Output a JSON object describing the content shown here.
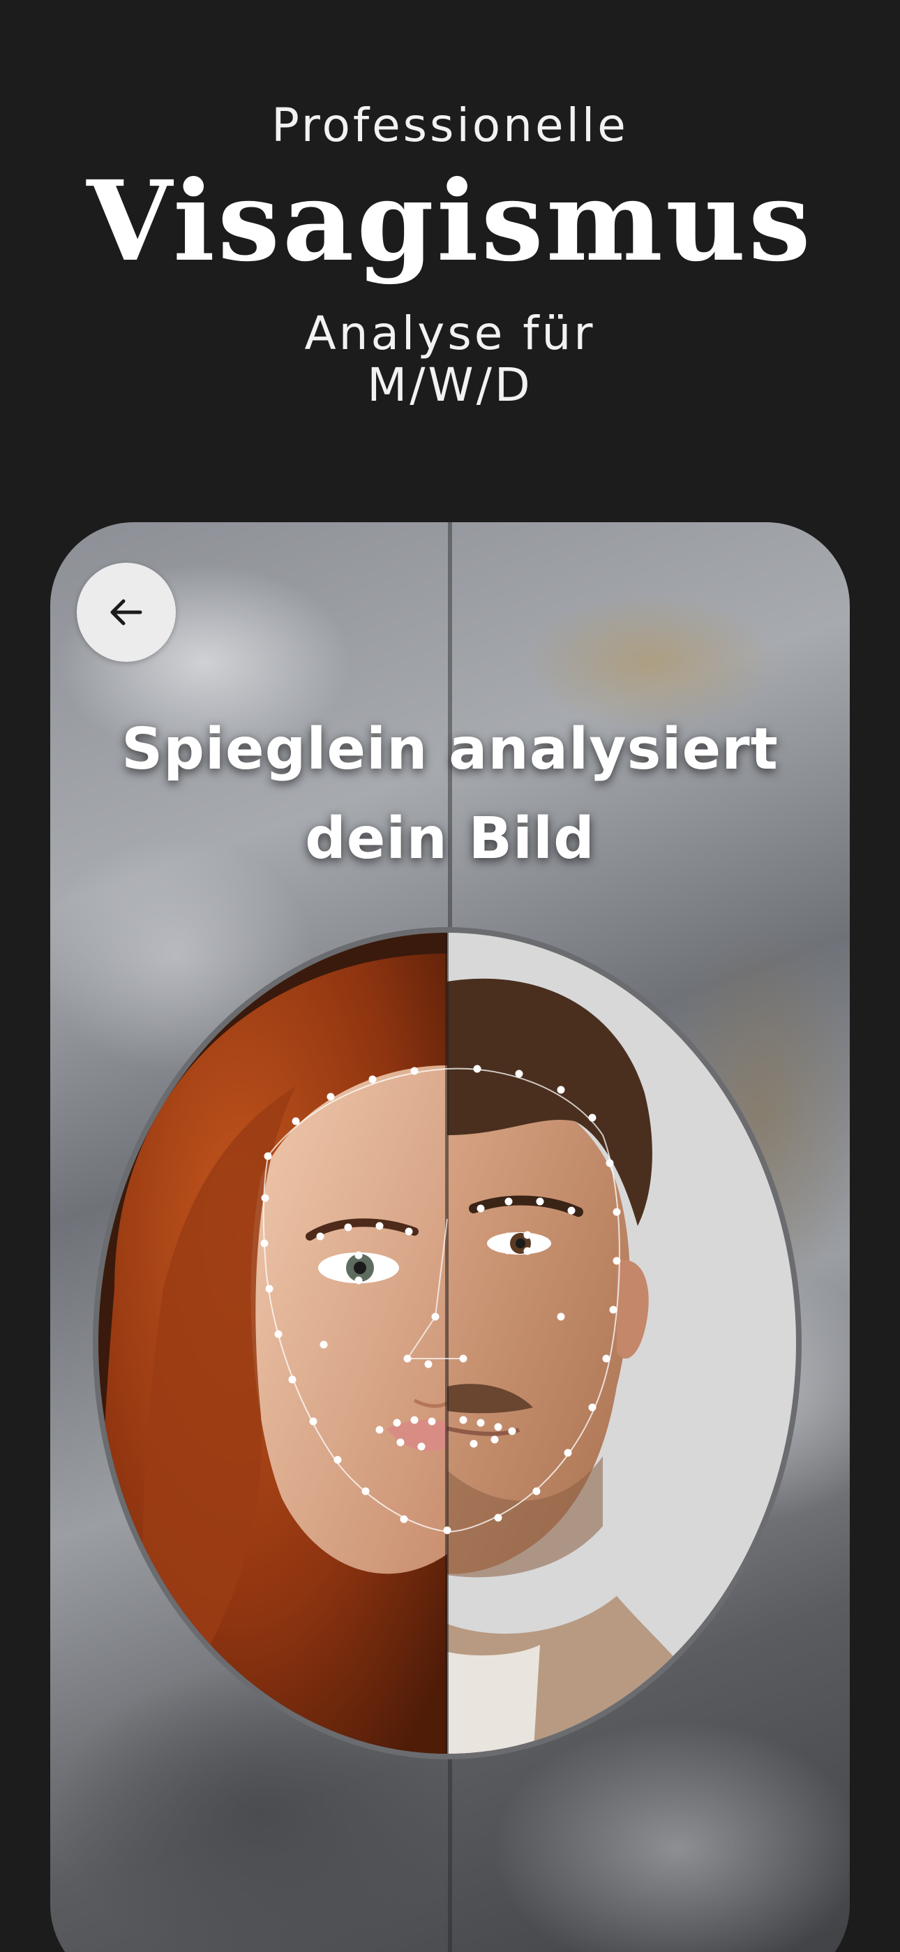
{
  "header": {
    "pre_title": "Professionelle",
    "title": "Visagismus",
    "subtitle_line1": "Analyse für",
    "subtitle_line2": "M/W/D"
  },
  "card": {
    "back_icon": "arrow-left-icon",
    "headline_line1": "Spieglein analysiert",
    "headline_line2": "dein Bild",
    "image": "split-face-portrait-with-landmark-mesh"
  },
  "colors": {
    "background": "#1c1c1c",
    "text": "#ffffff",
    "back_button": "#ececec",
    "hair_female": "#9c3a12",
    "hair_male": "#4a2f1e"
  }
}
